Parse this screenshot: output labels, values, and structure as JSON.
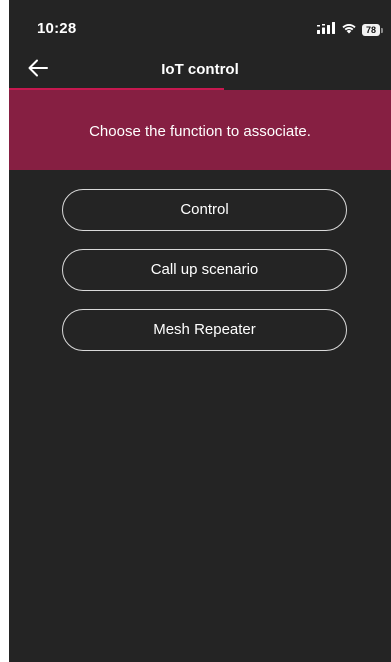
{
  "status_bar": {
    "time": "10:28",
    "battery": "78",
    "signal_icon": "signal-icon",
    "wifi_icon": "wifi-icon"
  },
  "nav": {
    "title": "IoT control",
    "back_icon": "back-arrow-icon",
    "accent_color": "#c6184f"
  },
  "banner": {
    "text": "Choose the function to associate.",
    "color": "#861f42"
  },
  "options": [
    {
      "label": "Control"
    },
    {
      "label": "Call up scenario"
    },
    {
      "label": "Mesh Repeater"
    }
  ],
  "theme": {
    "background": "#242424",
    "text": "#ffffff"
  }
}
